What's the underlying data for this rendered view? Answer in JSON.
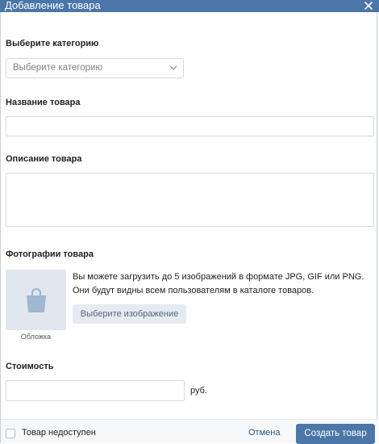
{
  "dialog": {
    "title": "Добавление товара"
  },
  "category": {
    "label": "Выберите категорию",
    "selected": "Выберите категорию"
  },
  "name": {
    "label": "Название товара",
    "value": ""
  },
  "description": {
    "label": "Описание товара",
    "value": ""
  },
  "photos": {
    "label": "Фотографии товара",
    "cover_caption": "Обложка",
    "description": "Вы можете загрузить до 5 изображений в формате JPG, GIF или PNG. Они будут видны всем пользователям в каталоге товаров.",
    "choose_button": "Выберите изображение"
  },
  "price": {
    "label": "Стоимость",
    "value": "",
    "currency": "руб."
  },
  "footer": {
    "unavailable_label": "Товар недоступен",
    "unavailable_checked": false,
    "cancel_label": "Отмена",
    "submit_label": "Создать товар"
  },
  "colors": {
    "accent": "#4a76a8",
    "link": "#2a5885",
    "secondary_button_bg": "#e5ebf1",
    "placeholder_bg": "#e1e7ee",
    "bag_icon": "#9fb7d0"
  }
}
